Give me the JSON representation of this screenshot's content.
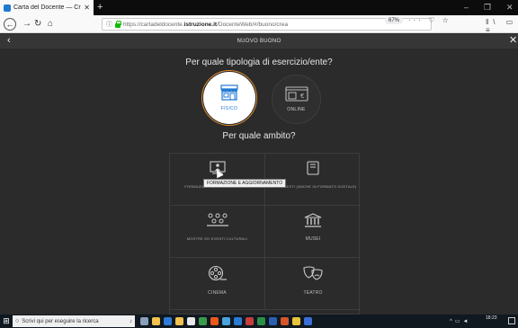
{
  "browser": {
    "tab_title": "Carta del Docente — Crea buo",
    "url_prefix": "https://cartadeldocente.",
    "url_domain": "istruzione.it",
    "url_path": "/DocenteWeb/#/buono/crea",
    "zoom": "67%"
  },
  "page": {
    "title": "NUOVO BUONO",
    "question_type": "Per quale tipologia di esercizio/ente?",
    "question_scope": "Per quale ambito?",
    "types": [
      {
        "label": "FISICO",
        "icon": "storefront-icon",
        "selected": true
      },
      {
        "label": "ONLINE",
        "icon": "online-shop-icon",
        "selected": false
      }
    ],
    "categories": [
      {
        "label": "FORMAZIONE E AGGIORNAMENTO",
        "icon": "training-icon"
      },
      {
        "label": "LIBRI E TESTI (ANCHE IN FORMATO DIGITALE)",
        "icon": "book-icon"
      },
      {
        "label": "MOSTRE ED EVENTI CULTURALI",
        "icon": "audience-icon"
      },
      {
        "label": "MUSEI",
        "icon": "museum-icon"
      },
      {
        "label": "CINEMA",
        "icon": "film-reel-icon"
      },
      {
        "label": "TEATRO",
        "icon": "theater-masks-icon"
      }
    ],
    "tooltip": "FORMAZIONE E AGGIORNAMENTO"
  },
  "taskbar": {
    "search_placeholder": "Scrivi qui per eseguire la ricerca",
    "time": "18:23"
  },
  "colors": {
    "page_bg": "#2b2b2b",
    "selected_outline": "#e08a2c",
    "accent_blue": "#1f78d1"
  }
}
